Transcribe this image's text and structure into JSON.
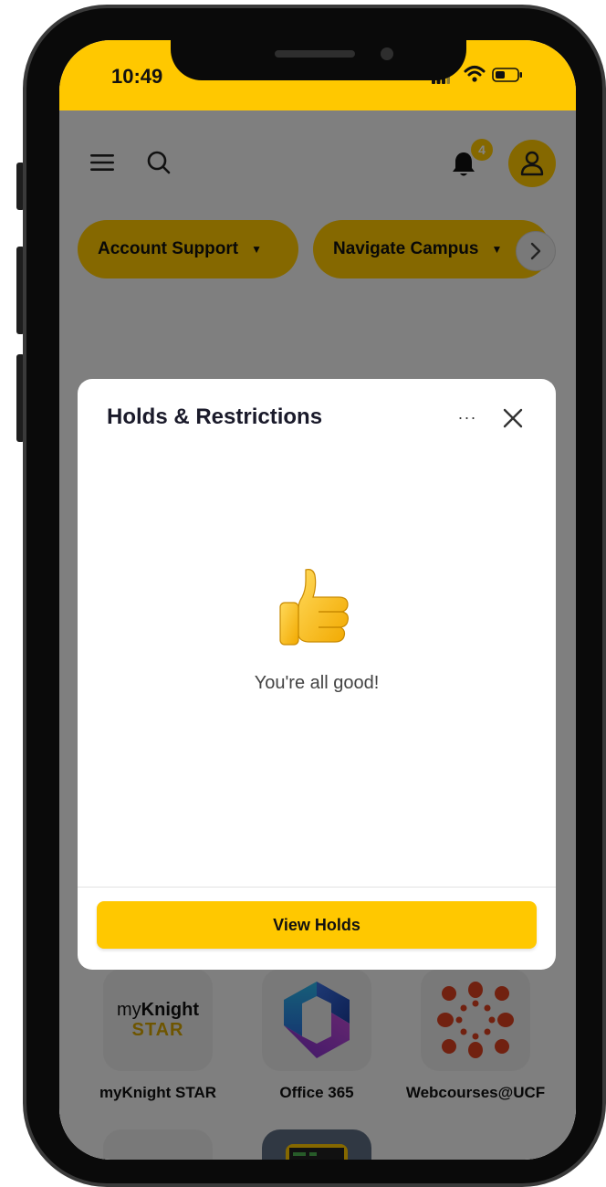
{
  "status_bar": {
    "time": "10:49"
  },
  "header": {
    "notification_count": "4"
  },
  "quick_links": [
    {
      "label": "Account Support"
    },
    {
      "label": "Navigate Campus"
    }
  ],
  "modal": {
    "title": "Holds & Restrictions",
    "more_label": "···",
    "message": "You're all good!",
    "action_label": "View Holds"
  },
  "apps": [
    {
      "label": "myKnight STAR",
      "logo_top": "my",
      "logo_bold": "Knight",
      "logo_bottom": "STAR"
    },
    {
      "label": "Office 365"
    },
    {
      "label": "Webcourses@UCF"
    }
  ],
  "colors": {
    "brand_gold": "#ffc800",
    "webcourses_red": "#d9401f",
    "workday_blue": "#0b5aa0",
    "workday_orange": "#f5a623"
  },
  "icons": [
    "menu-icon",
    "search-icon",
    "bell-icon",
    "user-icon",
    "chevron-right-icon",
    "more-icon",
    "close-icon",
    "thumbs-up-icon"
  ]
}
